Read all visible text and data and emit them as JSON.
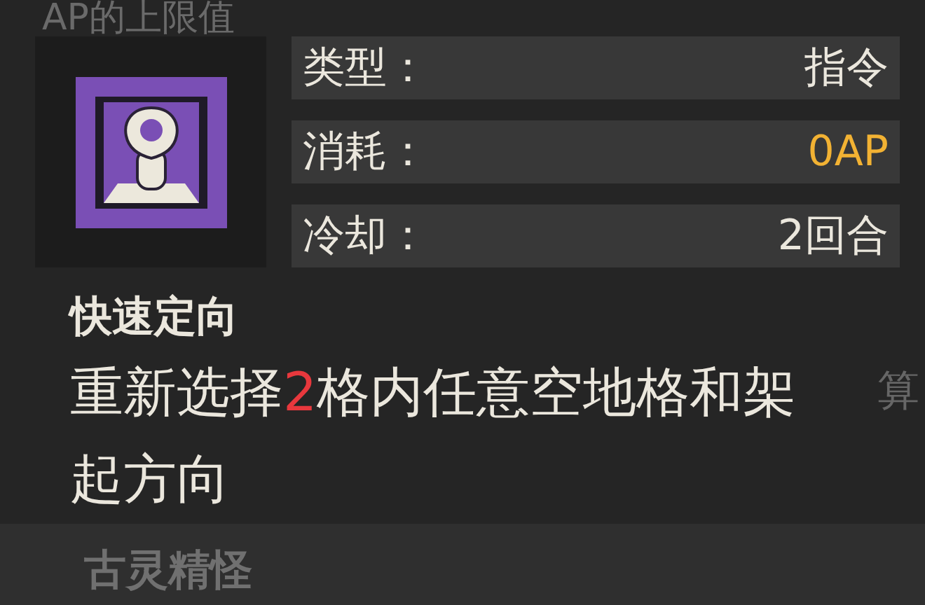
{
  "background": {
    "top_text": "AP的上限值",
    "side_text": "算",
    "bottom_text": "古灵精怪"
  },
  "skill": {
    "stats": [
      {
        "label": "类型：",
        "value": "指令",
        "highlight": false
      },
      {
        "label": "消耗：",
        "value": "0AP",
        "highlight": true
      },
      {
        "label": "冷却：",
        "value": "2回合",
        "highlight": false
      }
    ],
    "name": "快速定向",
    "description": [
      {
        "text": "重新选择",
        "emphasis": false
      },
      {
        "text": "2",
        "emphasis": true
      },
      {
        "text": "格内任意空地格和架起方向",
        "emphasis": false
      }
    ]
  }
}
